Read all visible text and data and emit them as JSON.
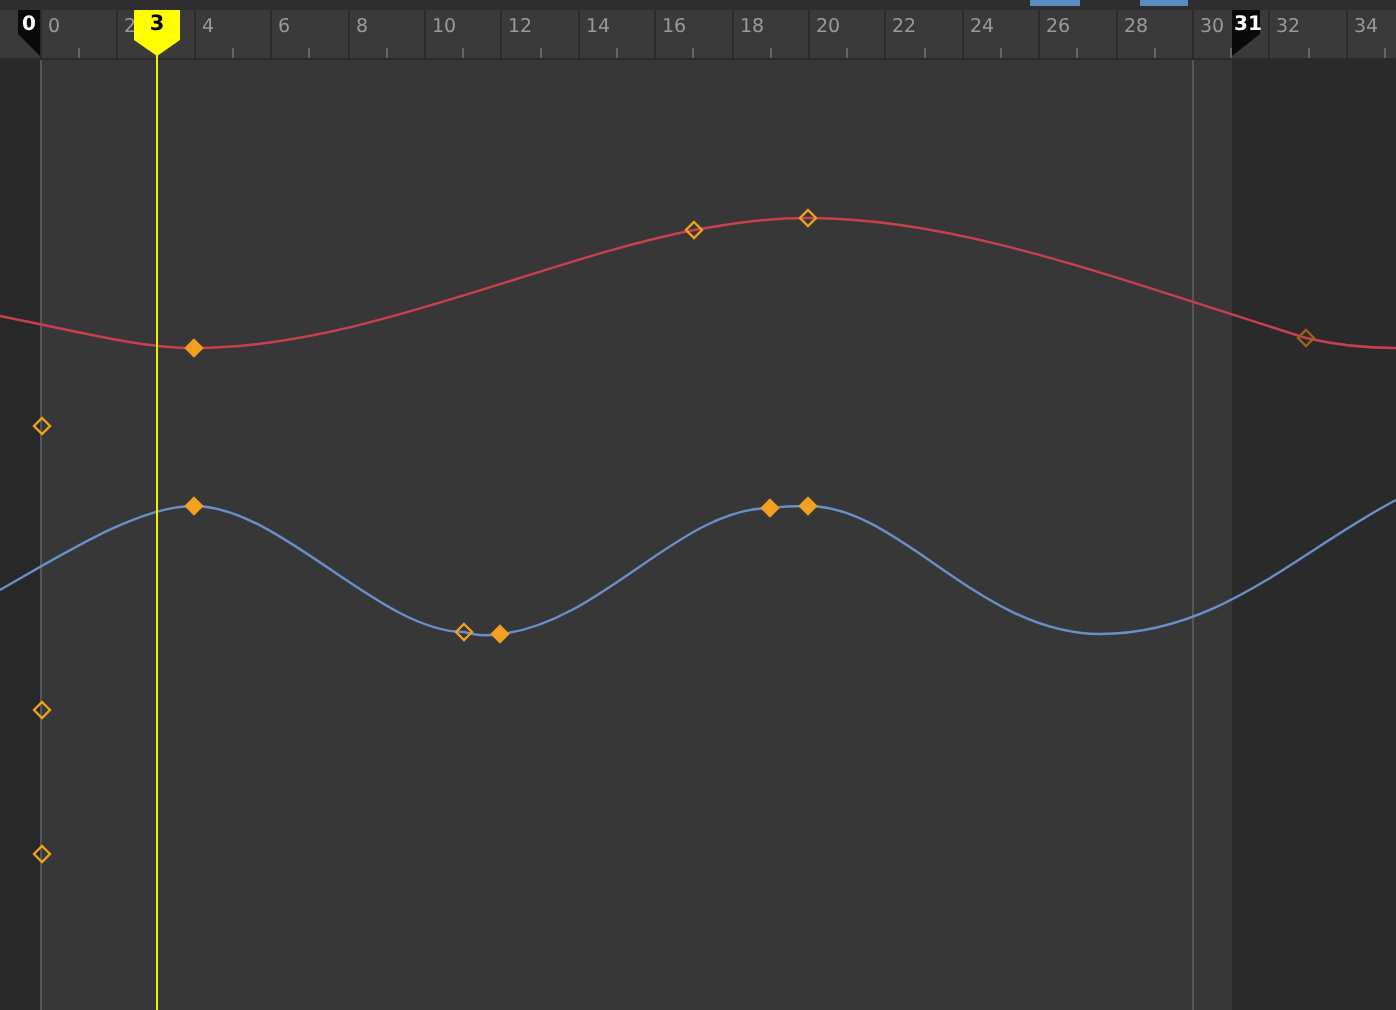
{
  "ruler": {
    "ticks": [
      "0",
      "2",
      "4",
      "6",
      "8",
      "10",
      "12",
      "14",
      "16",
      "18",
      "20",
      "22",
      "24",
      "26",
      "28",
      "30",
      "32",
      "34"
    ]
  },
  "playhead": {
    "label": "3"
  },
  "range": {
    "start": "0",
    "end": "31"
  },
  "curves": [
    {
      "color": "#c8404e",
      "keys": [
        {
          "selected": true
        },
        {
          "selected": false
        },
        {
          "selected": false
        },
        {
          "selected": false
        }
      ]
    },
    {
      "color": "#6a8fc8",
      "keys": [
        {
          "selected": true
        },
        {
          "selected": false
        },
        {
          "selected": true
        },
        {
          "selected": true
        },
        {
          "selected": true
        }
      ]
    }
  ],
  "loose_keys": [
    {
      "selected": false
    },
    {
      "selected": false
    },
    {
      "selected": false
    }
  ]
}
